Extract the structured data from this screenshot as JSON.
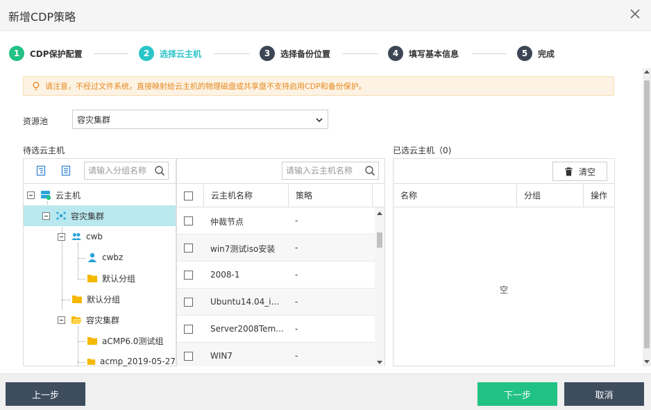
{
  "dialog": {
    "title": "新增CDP策略",
    "close_label": "×"
  },
  "steps": [
    {
      "num": "1",
      "label": "CDP保护配置",
      "state": "done"
    },
    {
      "num": "2",
      "label": "选择云主机",
      "state": "active"
    },
    {
      "num": "3",
      "label": "选择备份位置",
      "state": "todo"
    },
    {
      "num": "4",
      "label": "填写基本信息",
      "state": "todo"
    },
    {
      "num": "5",
      "label": "完成",
      "state": "todo"
    }
  ],
  "notice": {
    "text": "请注意，不经过文件系统，直接映射给云主机的物理磁盘或共享盘不支持启用CDP和备份保护。"
  },
  "pool": {
    "label": "资源池",
    "value": "容灾集群"
  },
  "candidate": {
    "title": "待选云主机",
    "group_search_placeholder": "请输入分组名称",
    "vm_search_placeholder": "请输入云主机名称"
  },
  "tree": [
    {
      "label": "云主机",
      "icon": "cloud-host-icon"
    },
    {
      "label": "容灾集群",
      "icon": "cluster-icon",
      "selected": true
    },
    {
      "label": "cwb",
      "icon": "user-group-icon"
    },
    {
      "label": "cwbz",
      "icon": "user-icon"
    },
    {
      "label": "默认分组",
      "icon": "folder-icon"
    },
    {
      "label": "默认分组",
      "icon": "folder-icon"
    },
    {
      "label": "容灾集群",
      "icon": "folder-open-icon"
    },
    {
      "label": "aCMP6.0测试组",
      "icon": "folder-icon"
    },
    {
      "label": "acmp_2019-05-27",
      "icon": "folder-icon"
    }
  ],
  "vm_table": {
    "headers": {
      "name": "云主机名称",
      "policy": "策略"
    },
    "rows": [
      {
        "name": "仲裁节点",
        "policy": "-"
      },
      {
        "name": "win7测试iso安装",
        "policy": "-"
      },
      {
        "name": "2008-1",
        "policy": "-"
      },
      {
        "name": "Ubuntu14.04_i...",
        "policy": "-"
      },
      {
        "name": "Server2008Tem...",
        "policy": "-"
      },
      {
        "name": "WIN7",
        "policy": "-"
      }
    ]
  },
  "selected": {
    "title": "已选云主机（0)",
    "clear_label": "清空",
    "headers": {
      "name": "名称",
      "group": "分组",
      "action": "操作"
    },
    "empty_text": "空"
  },
  "footer": {
    "prev_label": "上一步",
    "next_label": "下一步",
    "cancel_label": "取消"
  },
  "colors": {
    "accent": "#2ac5c8",
    "success": "#22c184",
    "dark": "#3d4d5e",
    "notice": "#e6881e"
  }
}
